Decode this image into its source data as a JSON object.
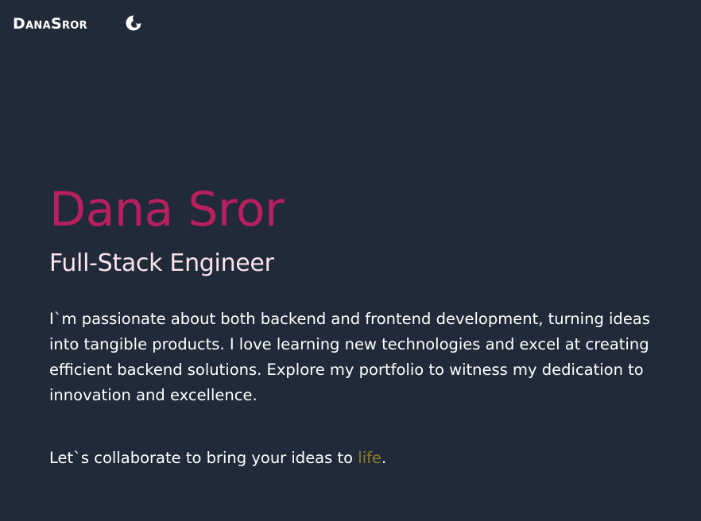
{
  "header": {
    "logo_text": "DanaSror",
    "theme_toggle_icon": "moon-stars-icon"
  },
  "hero": {
    "name": "Dana Sror",
    "role": "Full-Stack Engineer",
    "bio": "I`m passionate about both backend and frontend development, turning ideas into tangible products. I love learning new technologies and excel at creating efficient backend solutions. Explore my portfolio to witness my dedication to innovation and excellence.",
    "cta_prefix": "Let`s collaborate to bring your ideas to ",
    "cta_highlight": "life",
    "cta_suffix": "."
  },
  "colors": {
    "background": "#212a39",
    "name_accent": "#b81f5f",
    "role_text": "#fbe3ea",
    "highlight": "#8b7b2b"
  }
}
